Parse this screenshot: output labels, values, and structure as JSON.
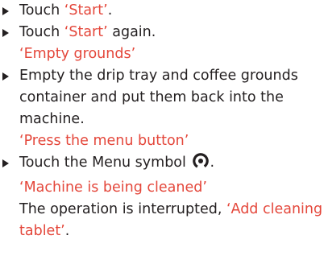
{
  "steps": [
    {
      "prefix": "Touch ",
      "highlight": "‘Start’",
      "suffix": "."
    },
    {
      "prefix": "Touch ",
      "highlight": "‘Start’",
      "suffix": " again.",
      "display": "‘Empty grounds’"
    },
    {
      "lines": [
        "Empty the drip tray and coffee grounds",
        "container and put them back into the",
        "machine."
      ],
      "display": "‘Press the menu button’"
    },
    {
      "text": "Touch the Menu symbol",
      "icon": "menu-symbol-icon",
      "suffix": ".",
      "display": "‘Machine is being cleaned’",
      "note_prefix": "The operation is interrupted, ",
      "note_highlight_1": "‘Add cleaning",
      "note_highlight_2": "tablet’",
      "note_suffix": "."
    }
  ],
  "colors": {
    "text": "#231f20",
    "highlight": "#e4473b"
  }
}
